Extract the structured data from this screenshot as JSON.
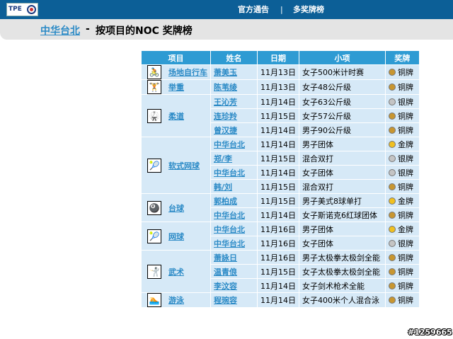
{
  "header": {
    "logo_text": "TPE",
    "nav": [
      "官方通告",
      "多奖牌榜"
    ],
    "nav_sep": "|"
  },
  "breadcrumb": {
    "link": "中华台北",
    "sep": "-",
    "title": "按项目的NOC 奖牌榜"
  },
  "table": {
    "headers": [
      "项目",
      "姓名",
      "日期",
      "小项",
      "奖牌"
    ],
    "medal_colors": {
      "金牌": "#f0c020",
      "银牌": "#c4c4c4",
      "铜牌": "#c89630"
    },
    "groups": [
      {
        "sport": "场地自行车",
        "icon": "cycling-icon",
        "glyph": "🚴",
        "rows": [
          {
            "athlete": "萧美玉",
            "date": "11月13日",
            "event": "女子500米计时赛",
            "medal": "铜牌"
          }
        ]
      },
      {
        "sport": "举重",
        "icon": "weightlifting-icon",
        "glyph": "🏋",
        "rows": [
          {
            "athlete": "陈苇绫",
            "date": "11月13日",
            "event": "女子48公斤级",
            "medal": "铜牌"
          }
        ]
      },
      {
        "sport": "柔道",
        "icon": "judo-icon",
        "glyph": "🥋",
        "rows": [
          {
            "athlete": "王沁芳",
            "date": "11月14日",
            "event": "女子63公斤级",
            "medal": "银牌"
          },
          {
            "athlete": "连珍羚",
            "date": "11月15日",
            "event": "女子57公斤级",
            "medal": "铜牌"
          },
          {
            "athlete": "曾汉捷",
            "date": "11月14日",
            "event": "男子90公斤级",
            "medal": "铜牌"
          }
        ]
      },
      {
        "sport": "软式网球",
        "icon": "soft-tennis-icon",
        "glyph": "🎾",
        "rows": [
          {
            "athlete": "中华台北",
            "date": "11月14日",
            "event": "男子团体",
            "medal": "金牌"
          },
          {
            "athlete": "郑/李",
            "date": "11月15日",
            "event": "混合双打",
            "medal": "银牌"
          },
          {
            "athlete": "中华台北",
            "date": "11月14日",
            "event": "女子团体",
            "medal": "银牌"
          },
          {
            "athlete": "韩/刘",
            "date": "11月15日",
            "event": "混合双打",
            "medal": "铜牌"
          }
        ]
      },
      {
        "sport": "台球",
        "icon": "billiards-icon",
        "glyph": "🎱",
        "rows": [
          {
            "athlete": "郭柏成",
            "date": "11月15日",
            "event": "男子美式8球单打",
            "medal": "金牌"
          },
          {
            "athlete": "中华台北",
            "date": "11月14日",
            "event": "女子斯诺克6红球团体",
            "medal": "铜牌"
          }
        ]
      },
      {
        "sport": "网球",
        "icon": "tennis-icon",
        "glyph": "🎾",
        "rows": [
          {
            "athlete": "中华台北",
            "date": "11月16日",
            "event": "男子团体",
            "medal": "金牌"
          },
          {
            "athlete": "中华台北",
            "date": "11月16日",
            "event": "女子团体",
            "medal": "银牌"
          }
        ]
      },
      {
        "sport": "武术",
        "icon": "wushu-icon",
        "glyph": "🤺",
        "rows": [
          {
            "athlete": "萧詠日",
            "date": "11月16日",
            "event": "男子太极拳太极剑全能",
            "medal": "铜牌"
          },
          {
            "athlete": "温青俍",
            "date": "11月15日",
            "event": "女子太极拳太极剑全能",
            "medal": "铜牌"
          },
          {
            "athlete": "李汶容",
            "date": "11月14日",
            "event": "女子剑术枪术全能",
            "medal": "铜牌"
          }
        ]
      },
      {
        "sport": "游泳",
        "icon": "swimming-icon",
        "glyph": "🏊",
        "rows": [
          {
            "athlete": "程琬容",
            "date": "11月14日",
            "event": "女子400米个人混合泳",
            "medal": "铜牌"
          }
        ]
      }
    ]
  },
  "watermark": "#1259665"
}
